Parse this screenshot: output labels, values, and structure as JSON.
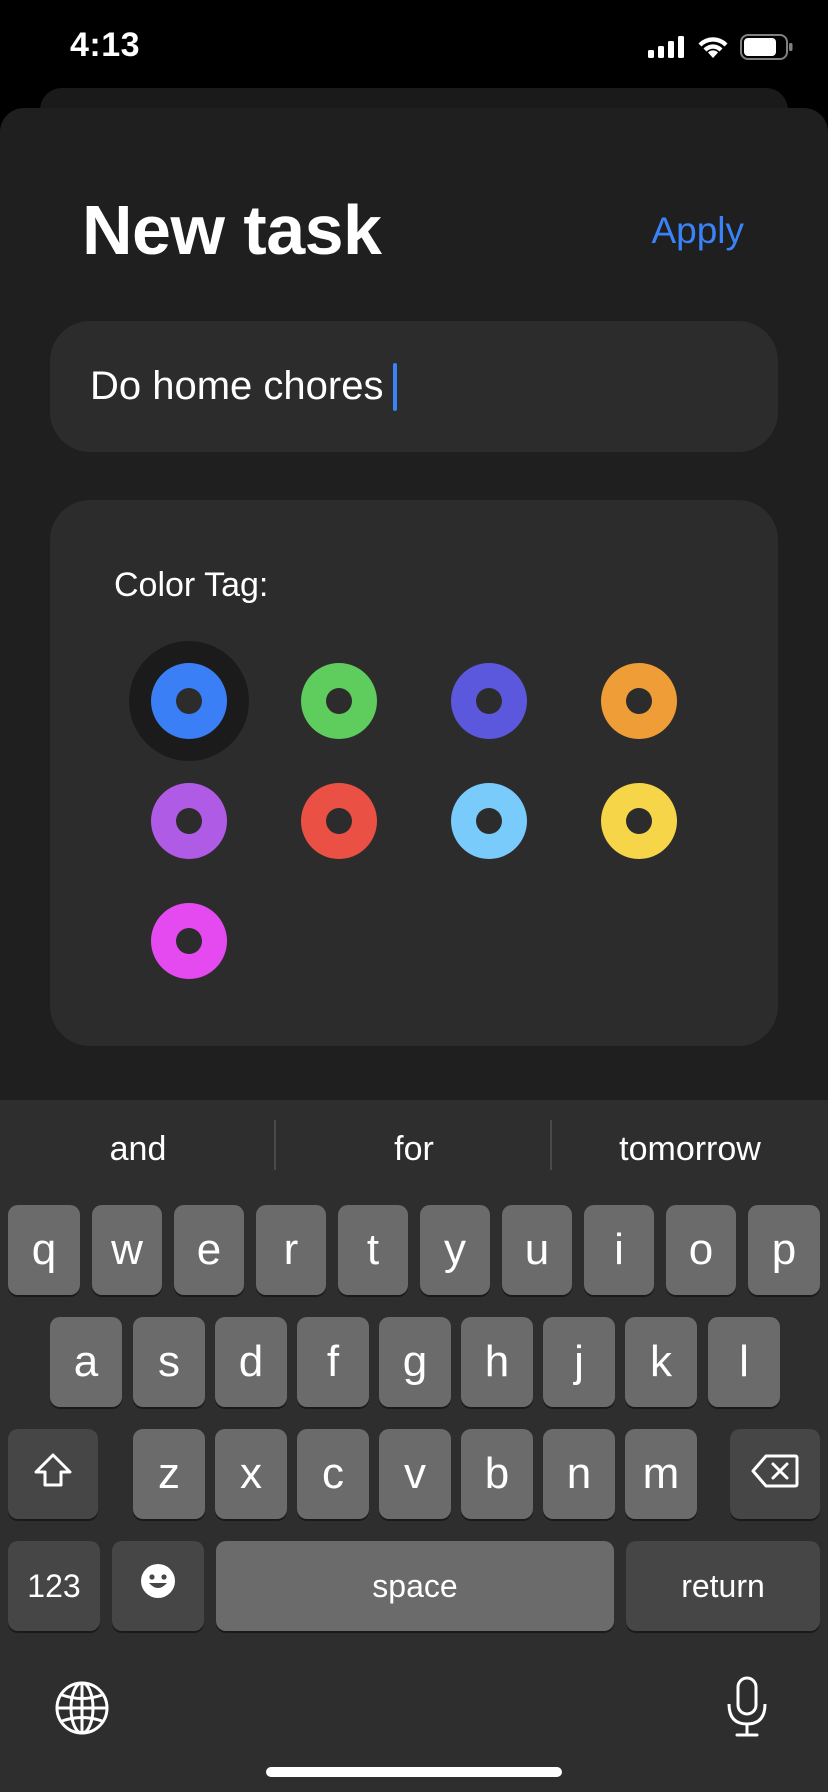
{
  "status_bar": {
    "time": "4:13"
  },
  "header": {
    "title": "New task",
    "apply_label": "Apply"
  },
  "task_input": {
    "value": "Do home chores"
  },
  "color_tag": {
    "label": "Color Tag:",
    "selected": "blue",
    "colors": [
      {
        "name": "blue",
        "hex": "#3a7ff6"
      },
      {
        "name": "green",
        "hex": "#5fcc5e"
      },
      {
        "name": "indigo",
        "hex": "#5c58de"
      },
      {
        "name": "orange",
        "hex": "#ef9d37"
      },
      {
        "name": "purple",
        "hex": "#b05be6"
      },
      {
        "name": "red",
        "hex": "#ea5144"
      },
      {
        "name": "light-blue",
        "hex": "#78cbfb"
      },
      {
        "name": "yellow",
        "hex": "#f6d548"
      },
      {
        "name": "magenta",
        "hex": "#e54af0"
      }
    ]
  },
  "keyboard": {
    "suggestions": [
      "and",
      "for",
      "tomorrow"
    ],
    "row1": [
      "q",
      "w",
      "e",
      "r",
      "t",
      "y",
      "u",
      "i",
      "o",
      "p"
    ],
    "row2": [
      "a",
      "s",
      "d",
      "f",
      "g",
      "h",
      "j",
      "k",
      "l"
    ],
    "row3": [
      "z",
      "x",
      "c",
      "v",
      "b",
      "n",
      "m"
    ],
    "numbers_label": "123",
    "space_label": "space",
    "return_label": "return"
  }
}
